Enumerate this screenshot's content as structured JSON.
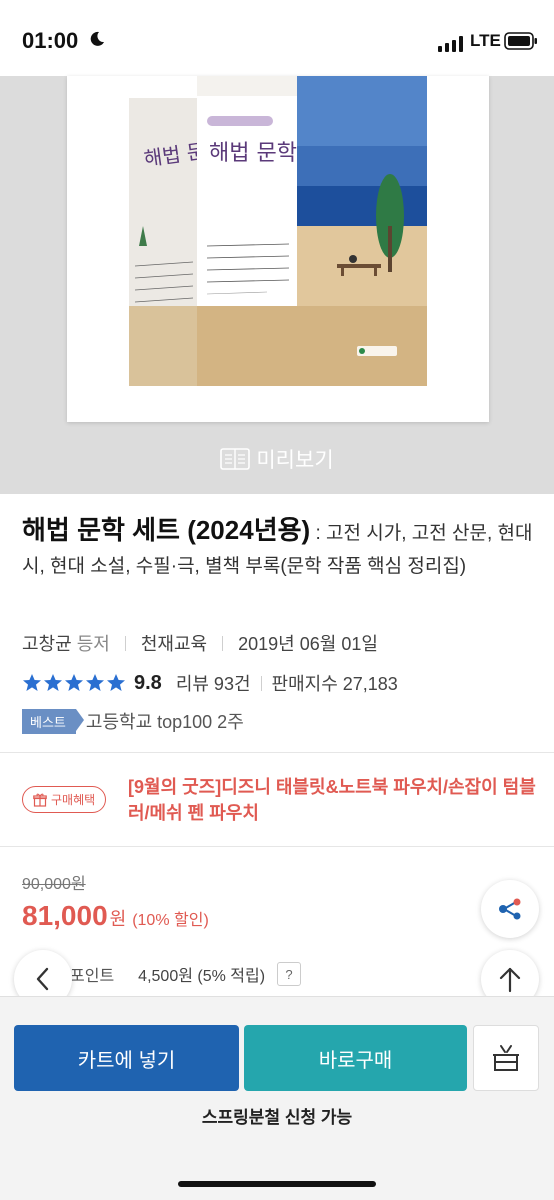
{
  "status_bar": {
    "time": "01:00",
    "network": "LTE"
  },
  "cover": {
    "preview_label": "미리보기",
    "book_title_art": "해법 문학"
  },
  "product": {
    "title": "해법 문학 세트 (2024년용)",
    "subtitle": " : 고전 시가, 고전 산문, 현대 시, 현대 소설, 수필·극, 별책 부록(문학 작품 핵심 정리집)",
    "author": "고창균",
    "author_role": "등저",
    "publisher": "천재교육",
    "pub_date": "2019년 06월 01일",
    "rating": "9.8",
    "review_count": "리뷰 93건",
    "sales_index": "판매지수 27,183",
    "best_badge": "베스트",
    "best_rank": "고등학교 top100 2주"
  },
  "benefit": {
    "badge": "구매혜택",
    "text": "[9월의 굿즈]디즈니 태블릿&노트북 파우치/손잡이 텀블러/메쉬 펜 파우치"
  },
  "price": {
    "list_price": "90,000원",
    "sale_price": "81,000",
    "won": "원",
    "discount": "(10% 할인)",
    "point_label": "포인트",
    "point_value": "4,500원 (5% 적립)",
    "help": "?"
  },
  "actions": {
    "cart": "카트에 넣기",
    "buy": "바로구매",
    "installment": "스프링분철 신청 가능"
  },
  "colors": {
    "accent_red": "#e05a52",
    "cart_blue": "#1f63b0",
    "buy_teal": "#25a6ad",
    "best_blue": "#6a8fc4",
    "star_blue": "#2a6fd1"
  }
}
